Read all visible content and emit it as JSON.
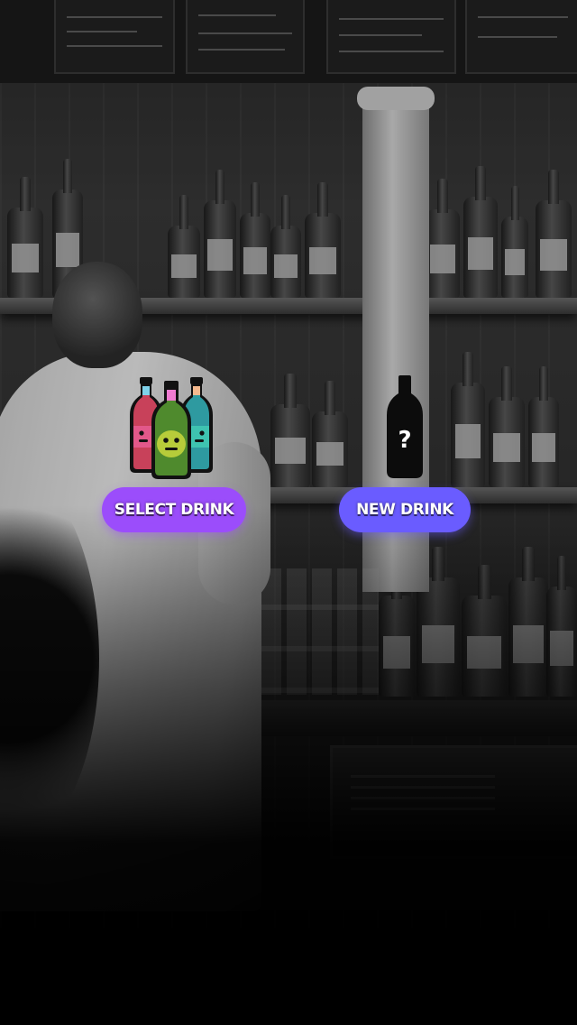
{
  "actions": {
    "select": {
      "label": "SELECT DRINK",
      "icon": "three-bottles-icon",
      "color": "#9b4dfb"
    },
    "new": {
      "label": "NEW DRINK",
      "icon": "mystery-bottle-icon",
      "icon_glyph": "?",
      "color": "#6a5cff"
    }
  },
  "background": {
    "scene": "bar-background-photo",
    "tone": "grayscale"
  }
}
